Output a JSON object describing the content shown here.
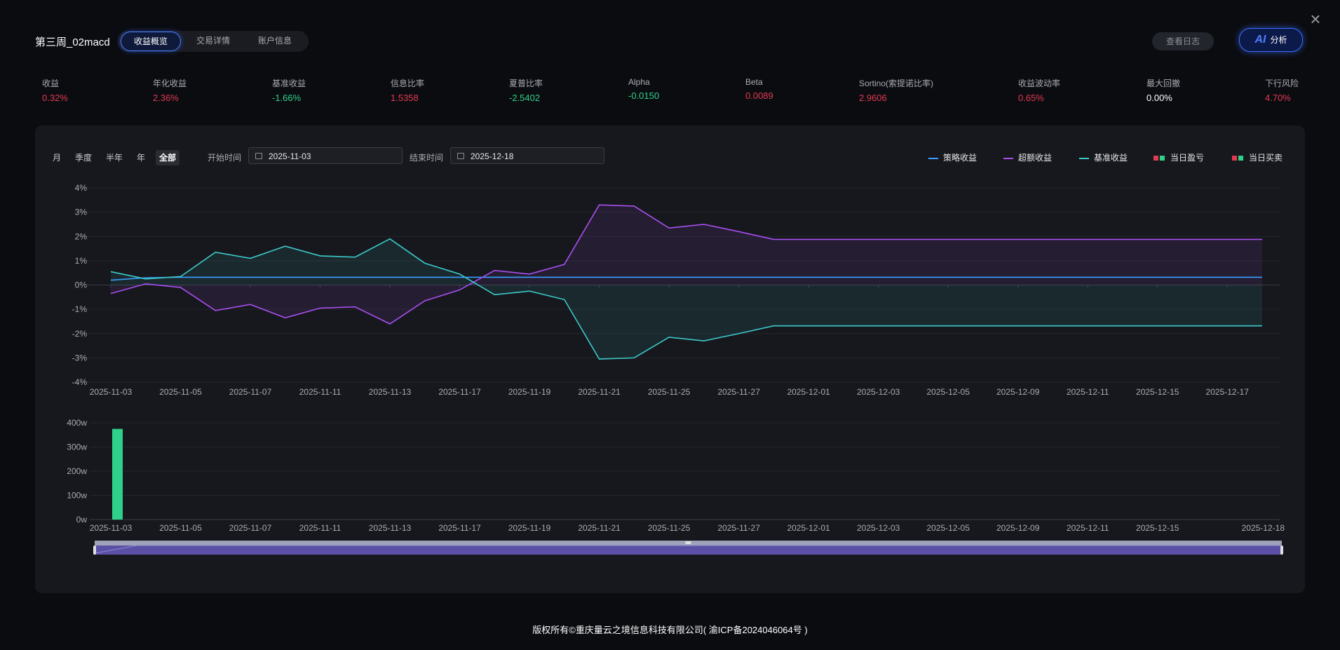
{
  "header": {
    "strategy_name": "第三周_02macd",
    "tabs": [
      {
        "label": "收益概览",
        "active": true
      },
      {
        "label": "交易详情",
        "active": false
      },
      {
        "label": "账户信息",
        "active": false
      }
    ],
    "view_log_label": "查看日志",
    "ai_icon_text": "AI",
    "ai_label": "分析",
    "close_icon": "close-icon"
  },
  "metrics": [
    {
      "label": "收益",
      "value": "0.32%",
      "color": "#e23a53"
    },
    {
      "label": "年化收益",
      "value": "2.36%",
      "color": "#e23a53"
    },
    {
      "label": "基准收益",
      "value": "-1.66%",
      "color": "#2fd08a"
    },
    {
      "label": "信息比率",
      "value": "1.5358",
      "color": "#e23a53"
    },
    {
      "label": "夏普比率",
      "value": "-2.5402",
      "color": "#2fd08a"
    },
    {
      "label": "Alpha",
      "value": "-0.0150",
      "color": "#2fd08a"
    },
    {
      "label": "Beta",
      "value": "0.0089",
      "color": "#e23a53"
    },
    {
      "label": "Sortino(索提诺比率)",
      "value": "2.9606",
      "color": "#e23a53"
    },
    {
      "label": "收益波动率",
      "value": "0.65%",
      "color": "#e23a53"
    },
    {
      "label": "最大回撤",
      "value": "0.00%",
      "color": "#ffffff"
    },
    {
      "label": "下行风险",
      "value": "4.70%",
      "color": "#e23a53"
    }
  ],
  "filters": {
    "periods": [
      "月",
      "季度",
      "半年",
      "年",
      "全部"
    ],
    "active_period": "全部",
    "start_label": "开始时间",
    "start_value": "2025-11-03",
    "end_label": "结束时间",
    "end_value": "2025-12-18"
  },
  "legend": [
    {
      "label": "策略收益",
      "type": "line",
      "color": "#3aa0ff"
    },
    {
      "label": "超额收益",
      "type": "line",
      "color": "#a84ff0"
    },
    {
      "label": "基准收益",
      "type": "line",
      "color": "#3cc9c9"
    },
    {
      "label": "当日盈亏",
      "type": "squares",
      "colors": [
        "#e23a53",
        "#2fd08a"
      ]
    },
    {
      "label": "当日买卖",
      "type": "squares",
      "colors": [
        "#e23a53",
        "#2fd08a"
      ]
    }
  ],
  "chart_data": [
    {
      "type": "line",
      "x": [
        "2025-11-03",
        "2025-11-04",
        "2025-11-05",
        "2025-11-06",
        "2025-11-07",
        "2025-11-10",
        "2025-11-11",
        "2025-11-12",
        "2025-11-13",
        "2025-11-14",
        "2025-11-17",
        "2025-11-18",
        "2025-11-19",
        "2025-11-20",
        "2025-11-21",
        "2025-11-24",
        "2025-11-25",
        "2025-11-26",
        "2025-11-27",
        "2025-11-28",
        "2025-12-01",
        "2025-12-02",
        "2025-12-03",
        "2025-12-04",
        "2025-12-05",
        "2025-12-08",
        "2025-12-09",
        "2025-12-10",
        "2025-12-11",
        "2025-12-12",
        "2025-12-15",
        "2025-12-16",
        "2025-12-17",
        "2025-12-18"
      ],
      "x_tick_labels": [
        "2025-11-03",
        "2025-11-05",
        "2025-11-07",
        "2025-11-11",
        "2025-11-13",
        "2025-11-17",
        "2025-11-19",
        "2025-11-21",
        "2025-11-25",
        "2025-11-27",
        "2025-12-01",
        "2025-12-03",
        "2025-12-05",
        "2025-12-09",
        "2025-12-11",
        "2025-12-15",
        "2025-12-17"
      ],
      "y_tick_labels": [
        "4%",
        "3%",
        "2%",
        "1%",
        "0%",
        "-1%",
        "-2%",
        "-3%",
        "-4%"
      ],
      "ylim": [
        -4,
        4
      ],
      "series": [
        {
          "name": "策略收益",
          "color": "#3aa0ff",
          "values": [
            0.2,
            0.3,
            0.32,
            0.32,
            0.32,
            0.32,
            0.32,
            0.32,
            0.32,
            0.32,
            0.32,
            0.32,
            0.32,
            0.32,
            0.32,
            0.32,
            0.32,
            0.32,
            0.32,
            0.32,
            0.32,
            0.32,
            0.32,
            0.32,
            0.32,
            0.32,
            0.32,
            0.32,
            0.32,
            0.32,
            0.32,
            0.32,
            0.32,
            0.32
          ]
        },
        {
          "name": "超额收益",
          "color": "#a84ff0",
          "values": [
            -0.35,
            0.05,
            -0.1,
            -1.05,
            -0.8,
            -1.35,
            -0.95,
            -0.9,
            -1.6,
            -0.65,
            -0.2,
            0.6,
            0.45,
            0.85,
            3.3,
            3.25,
            2.35,
            2.5,
            2.2,
            1.88,
            1.88,
            1.88,
            1.88,
            1.88,
            1.88,
            1.88,
            1.88,
            1.88,
            1.88,
            1.88,
            1.88,
            1.88,
            1.88,
            1.88
          ]
        },
        {
          "name": "基准收益",
          "color": "#3cc9c9",
          "values": [
            0.55,
            0.25,
            0.35,
            1.35,
            1.1,
            1.6,
            1.2,
            1.15,
            1.9,
            0.9,
            0.45,
            -0.4,
            -0.25,
            -0.6,
            -3.05,
            -3.0,
            -2.15,
            -2.3,
            -2.0,
            -1.68,
            -1.68,
            -1.68,
            -1.68,
            -1.68,
            -1.68,
            -1.68,
            -1.68,
            -1.68,
            -1.68,
            -1.68,
            -1.68,
            -1.68,
            -1.68,
            -1.68
          ]
        }
      ]
    },
    {
      "type": "bar",
      "categories": [
        "2025-11-03"
      ],
      "values": [
        375
      ],
      "color": "#2fd08a",
      "x_tick_labels": [
        "2025-11-03",
        "2025-11-05",
        "2025-11-07",
        "2025-11-11",
        "2025-11-13",
        "2025-11-17",
        "2025-11-19",
        "2025-11-21",
        "2025-11-25",
        "2025-11-27",
        "2025-12-01",
        "2025-12-03",
        "2025-12-05",
        "2025-12-09",
        "2025-12-11",
        "2025-12-15",
        "2025-12-18"
      ],
      "y_tick_labels": [
        "400w",
        "300w",
        "200w",
        "100w",
        "0w"
      ],
      "ylim": [
        0,
        400
      ]
    }
  ],
  "slider": {
    "range": [
      0,
      100
    ]
  },
  "footer": "版权所有©重庆量云之境信息科技有限公司( 渝ICP备2024046064号 )"
}
